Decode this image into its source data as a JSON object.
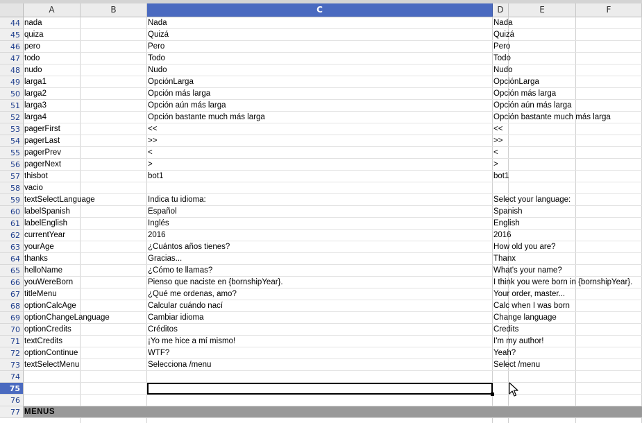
{
  "columns": [
    {
      "letter": "A"
    },
    {
      "letter": "B"
    },
    {
      "letter": "C",
      "selected": true
    },
    {
      "letter": "D"
    },
    {
      "letter": "E"
    },
    {
      "letter": "F"
    }
  ],
  "selected_row": 75,
  "rows": [
    {
      "n": "44",
      "a": "nada",
      "c": "Nada",
      "d": "Nada"
    },
    {
      "n": "45",
      "a": "quiza",
      "c": "Quizá",
      "d": "Quizá"
    },
    {
      "n": "46",
      "a": "pero",
      "c": "Pero",
      "d": "Pero"
    },
    {
      "n": "47",
      "a": "todo",
      "c": "Todo",
      "d": "Todo"
    },
    {
      "n": "48",
      "a": "nudo",
      "c": "Nudo",
      "d": "Nudo"
    },
    {
      "n": "49",
      "a": "larga1",
      "c": "OpciónLarga",
      "d": "OpciónLarga"
    },
    {
      "n": "50",
      "a": "larga2",
      "c": "Opción más larga",
      "d": "Opción más larga"
    },
    {
      "n": "51",
      "a": "larga3",
      "c": "Opción aún más larga",
      "d": "Opción aún más larga"
    },
    {
      "n": "52",
      "a": "larga4",
      "c": "Opción bastante much más larga",
      "d": "Opción bastante much más larga"
    },
    {
      "n": "53",
      "a": "pagerFirst",
      "c": "<<",
      "d": "<<"
    },
    {
      "n": "54",
      "a": "pagerLast",
      "c": ">>",
      "d": ">>"
    },
    {
      "n": "55",
      "a": "pagerPrev",
      "c": "<",
      "d": "<"
    },
    {
      "n": "56",
      "a": "pagerNext",
      "c": ">",
      "d": ">"
    },
    {
      "n": "57",
      "a": "thisbot",
      "c": "bot1",
      "d": "bot1"
    },
    {
      "n": "58",
      "a": "vacio",
      "c": "",
      "d": ""
    },
    {
      "n": "59",
      "a": "textSelectLanguage",
      "c": "Indica tu idioma:",
      "d": "Select your language:"
    },
    {
      "n": "60",
      "a": "labelSpanish",
      "c": "Español",
      "d": "Spanish"
    },
    {
      "n": "61",
      "a": "labelEnglish",
      "c": "Inglés",
      "d": "English"
    },
    {
      "n": "62",
      "a": "currentYear",
      "c": "2016",
      "d": "2016"
    },
    {
      "n": "63",
      "a": "yourAge",
      "c": "¿Cuántos años tienes?",
      "d": "How old you are?"
    },
    {
      "n": "64",
      "a": "thanks",
      "c": "Gracias...",
      "d": "Thanx"
    },
    {
      "n": "65",
      "a": "helloName",
      "c": "¿Cómo te llamas?",
      "d": "What's your name?"
    },
    {
      "n": "66",
      "a": "youWereBorn",
      "c": "Pienso que naciste en {bornshipYear}.",
      "d": "I think you were born in {bornshipYear}."
    },
    {
      "n": "67",
      "a": "titleMenu",
      "c": "¿Qué me ordenas, amo?",
      "d": "Your order, master..."
    },
    {
      "n": "68",
      "a": "optionCalcAge",
      "c": "Calcular cuándo nací",
      "d": "Calc when I was born"
    },
    {
      "n": "69",
      "a": "optionChangeLanguage",
      "c": "Cambiar idioma",
      "d": "Change language"
    },
    {
      "n": "70",
      "a": "optionCredits",
      "c": "Créditos",
      "d": "Credits"
    },
    {
      "n": "71",
      "a": "textCredits",
      "c": "¡Yo me hice a mí mismo!",
      "d": "I'm my author!"
    },
    {
      "n": "72",
      "a": "optionContinue",
      "c": "WTF?",
      "d": "Yeah?"
    },
    {
      "n": "73",
      "a": "textSelectMenu",
      "c": "Selecciona /menu",
      "d": "Select /menu"
    },
    {
      "n": "74",
      "a": "",
      "c": "",
      "d": ""
    },
    {
      "n": "75",
      "a": "",
      "c": "",
      "d": ""
    },
    {
      "n": "76",
      "a": "",
      "c": "",
      "d": ""
    },
    {
      "n": "77",
      "a": "MENUS",
      "c": "",
      "d": "",
      "style": "menus"
    }
  ]
}
